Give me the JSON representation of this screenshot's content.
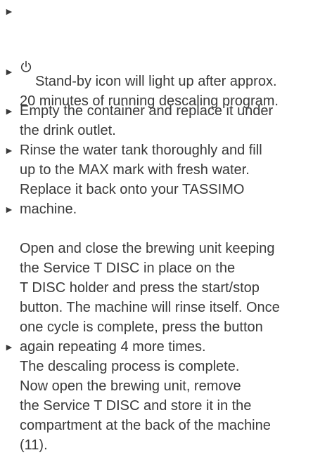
{
  "document": {
    "bullet_glyph": "►",
    "steps": [
      {
        "icon": "standby-icon",
        "text": "Stand-by icon will light up after approx.\n20 minutes of running descaling program."
      },
      {
        "text": "Empty the container and replace it under\nthe drink outlet."
      },
      {
        "text": "Rinse the water tank thoroughly and fill\nup to the MAX mark with fresh water."
      },
      {
        "text": "Replace it back onto your TASSIMO\nmachine."
      },
      {
        "text": "Open and close the brewing unit keeping\nthe Service T DISC in place on the\nT DISC holder and press the start/stop\nbutton. The machine will rinse itself. Once\none cycle is complete, press the button\nagain repeating 4 more times.",
        "continuation": "The descaling process is complete."
      },
      {
        "text": "Now open the brewing unit, remove\nthe Service T DISC and store it in the\ncompartment at the back of the machine\n(11)."
      }
    ]
  }
}
